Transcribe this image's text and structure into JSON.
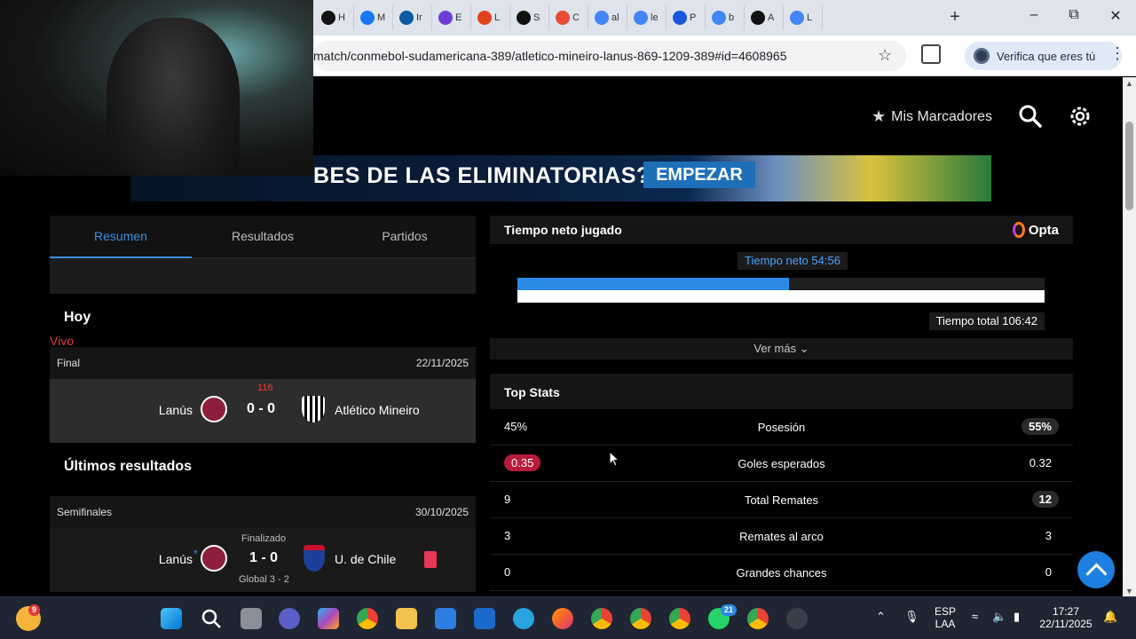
{
  "browser": {
    "tabs": [
      {
        "icon": "chatgpt-icon",
        "label": "H",
        "color": "#111111"
      },
      {
        "icon": "meta-icon",
        "label": "M",
        "color": "#1877f2"
      },
      {
        "icon": "edge-icon",
        "label": "Ir",
        "color": "#0c59a4"
      },
      {
        "icon": "shield-icon",
        "label": "E",
        "color": "#6b3fd6"
      },
      {
        "icon": "flame-icon",
        "label": "L",
        "color": "#e2401f"
      },
      {
        "icon": "chatgpt-icon",
        "label": "S",
        "color": "#111111"
      },
      {
        "icon": "copilot-icon",
        "label": "C",
        "color": "#e94b35"
      },
      {
        "icon": "google-icon",
        "label": "al",
        "color": "#4285f4"
      },
      {
        "icon": "google-icon",
        "label": "le",
        "color": "#4285f4"
      },
      {
        "icon": "docs-icon",
        "label": "P",
        "color": "#1a56db"
      },
      {
        "icon": "google-icon",
        "label": "b",
        "color": "#4285f4"
      },
      {
        "icon": "tv-icon",
        "label": "A",
        "color": "#111111"
      },
      {
        "icon": "google-icon",
        "label": "L",
        "color": "#4285f4"
      }
    ],
    "url": "match/conmebol-sudamericana-389/atletico-mineiro-lanus-869-1209-389#id=4608965",
    "profile_button": "Verifica que eres tú"
  },
  "nav": {
    "mis_marcadores": "Mis Marcadores"
  },
  "banner": {
    "question": "BES DE LAS ELIMINATORIAS?",
    "cta": "EMPEZAR"
  },
  "left": {
    "tabs": [
      "Resumen",
      "Resultados",
      "Partidos"
    ],
    "active_tab": "Resumen",
    "today_heading": "Hoy",
    "live_label": "Vivo",
    "today_match": {
      "stage": "Final",
      "date": "22/11/2025",
      "minute": "116",
      "home": "Lanús",
      "score": "0 - 0",
      "away": "Atlético Mineiro"
    },
    "recent_heading": "Últimos resultados",
    "recent_match": {
      "stage": "Semifinales",
      "date": "30/10/2025",
      "status": "Finalizado",
      "home": "Lanús",
      "score": "1 - 0",
      "away": "U. de Chile",
      "aggregate": "Global 3 - 2"
    }
  },
  "right": {
    "net_time_title": "Tiempo neto jugado",
    "provider": "Opta",
    "net_time_label": "Tiempo neto 54:56",
    "total_time_label": "Tiempo total 106:42",
    "net_time_fraction": 0.5147,
    "ver_mas": "Ver más",
    "top_stats_title": "Top Stats",
    "stats": [
      {
        "home": "45%",
        "label": "Posesión",
        "away": "55%",
        "highlight": "away"
      },
      {
        "home": "0.35",
        "label": "Goles esperados",
        "away": "0.32",
        "highlight": "home"
      },
      {
        "home": "9",
        "label": "Total Remates",
        "away": "12",
        "highlight": "away"
      },
      {
        "home": "3",
        "label": "Remates al arco",
        "away": "3",
        "highlight": "none"
      },
      {
        "home": "0",
        "label": "Grandes chances",
        "away": "0",
        "highlight": "none"
      }
    ]
  },
  "taskbar": {
    "weather_badge": "9",
    "whatsapp_badge": "21",
    "language": "ESP",
    "layout": "LAA",
    "time": "17:27",
    "date": "22/11/2025"
  }
}
